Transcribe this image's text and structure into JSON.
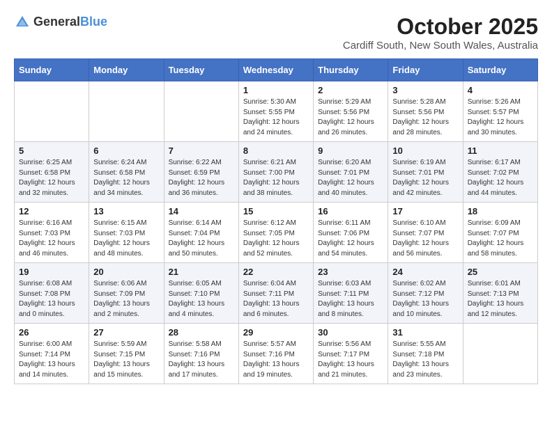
{
  "logo": {
    "general": "General",
    "blue": "Blue"
  },
  "title": "October 2025",
  "subtitle": "Cardiff South, New South Wales, Australia",
  "headers": [
    "Sunday",
    "Monday",
    "Tuesday",
    "Wednesday",
    "Thursday",
    "Friday",
    "Saturday"
  ],
  "weeks": [
    [
      {
        "day": "",
        "info": ""
      },
      {
        "day": "",
        "info": ""
      },
      {
        "day": "",
        "info": ""
      },
      {
        "day": "1",
        "info": "Sunrise: 5:30 AM\nSunset: 5:55 PM\nDaylight: 12 hours\nand 24 minutes."
      },
      {
        "day": "2",
        "info": "Sunrise: 5:29 AM\nSunset: 5:56 PM\nDaylight: 12 hours\nand 26 minutes."
      },
      {
        "day": "3",
        "info": "Sunrise: 5:28 AM\nSunset: 5:56 PM\nDaylight: 12 hours\nand 28 minutes."
      },
      {
        "day": "4",
        "info": "Sunrise: 5:26 AM\nSunset: 5:57 PM\nDaylight: 12 hours\nand 30 minutes."
      }
    ],
    [
      {
        "day": "5",
        "info": "Sunrise: 6:25 AM\nSunset: 6:58 PM\nDaylight: 12 hours\nand 32 minutes."
      },
      {
        "day": "6",
        "info": "Sunrise: 6:24 AM\nSunset: 6:58 PM\nDaylight: 12 hours\nand 34 minutes."
      },
      {
        "day": "7",
        "info": "Sunrise: 6:22 AM\nSunset: 6:59 PM\nDaylight: 12 hours\nand 36 minutes."
      },
      {
        "day": "8",
        "info": "Sunrise: 6:21 AM\nSunset: 7:00 PM\nDaylight: 12 hours\nand 38 minutes."
      },
      {
        "day": "9",
        "info": "Sunrise: 6:20 AM\nSunset: 7:01 PM\nDaylight: 12 hours\nand 40 minutes."
      },
      {
        "day": "10",
        "info": "Sunrise: 6:19 AM\nSunset: 7:01 PM\nDaylight: 12 hours\nand 42 minutes."
      },
      {
        "day": "11",
        "info": "Sunrise: 6:17 AM\nSunset: 7:02 PM\nDaylight: 12 hours\nand 44 minutes."
      }
    ],
    [
      {
        "day": "12",
        "info": "Sunrise: 6:16 AM\nSunset: 7:03 PM\nDaylight: 12 hours\nand 46 minutes."
      },
      {
        "day": "13",
        "info": "Sunrise: 6:15 AM\nSunset: 7:03 PM\nDaylight: 12 hours\nand 48 minutes."
      },
      {
        "day": "14",
        "info": "Sunrise: 6:14 AM\nSunset: 7:04 PM\nDaylight: 12 hours\nand 50 minutes."
      },
      {
        "day": "15",
        "info": "Sunrise: 6:12 AM\nSunset: 7:05 PM\nDaylight: 12 hours\nand 52 minutes."
      },
      {
        "day": "16",
        "info": "Sunrise: 6:11 AM\nSunset: 7:06 PM\nDaylight: 12 hours\nand 54 minutes."
      },
      {
        "day": "17",
        "info": "Sunrise: 6:10 AM\nSunset: 7:07 PM\nDaylight: 12 hours\nand 56 minutes."
      },
      {
        "day": "18",
        "info": "Sunrise: 6:09 AM\nSunset: 7:07 PM\nDaylight: 12 hours\nand 58 minutes."
      }
    ],
    [
      {
        "day": "19",
        "info": "Sunrise: 6:08 AM\nSunset: 7:08 PM\nDaylight: 13 hours\nand 0 minutes."
      },
      {
        "day": "20",
        "info": "Sunrise: 6:06 AM\nSunset: 7:09 PM\nDaylight: 13 hours\nand 2 minutes."
      },
      {
        "day": "21",
        "info": "Sunrise: 6:05 AM\nSunset: 7:10 PM\nDaylight: 13 hours\nand 4 minutes."
      },
      {
        "day": "22",
        "info": "Sunrise: 6:04 AM\nSunset: 7:11 PM\nDaylight: 13 hours\nand 6 minutes."
      },
      {
        "day": "23",
        "info": "Sunrise: 6:03 AM\nSunset: 7:11 PM\nDaylight: 13 hours\nand 8 minutes."
      },
      {
        "day": "24",
        "info": "Sunrise: 6:02 AM\nSunset: 7:12 PM\nDaylight: 13 hours\nand 10 minutes."
      },
      {
        "day": "25",
        "info": "Sunrise: 6:01 AM\nSunset: 7:13 PM\nDaylight: 13 hours\nand 12 minutes."
      }
    ],
    [
      {
        "day": "26",
        "info": "Sunrise: 6:00 AM\nSunset: 7:14 PM\nDaylight: 13 hours\nand 14 minutes."
      },
      {
        "day": "27",
        "info": "Sunrise: 5:59 AM\nSunset: 7:15 PM\nDaylight: 13 hours\nand 15 minutes."
      },
      {
        "day": "28",
        "info": "Sunrise: 5:58 AM\nSunset: 7:16 PM\nDaylight: 13 hours\nand 17 minutes."
      },
      {
        "day": "29",
        "info": "Sunrise: 5:57 AM\nSunset: 7:16 PM\nDaylight: 13 hours\nand 19 minutes."
      },
      {
        "day": "30",
        "info": "Sunrise: 5:56 AM\nSunset: 7:17 PM\nDaylight: 13 hours\nand 21 minutes."
      },
      {
        "day": "31",
        "info": "Sunrise: 5:55 AM\nSunset: 7:18 PM\nDaylight: 13 hours\nand 23 minutes."
      },
      {
        "day": "",
        "info": ""
      }
    ]
  ]
}
